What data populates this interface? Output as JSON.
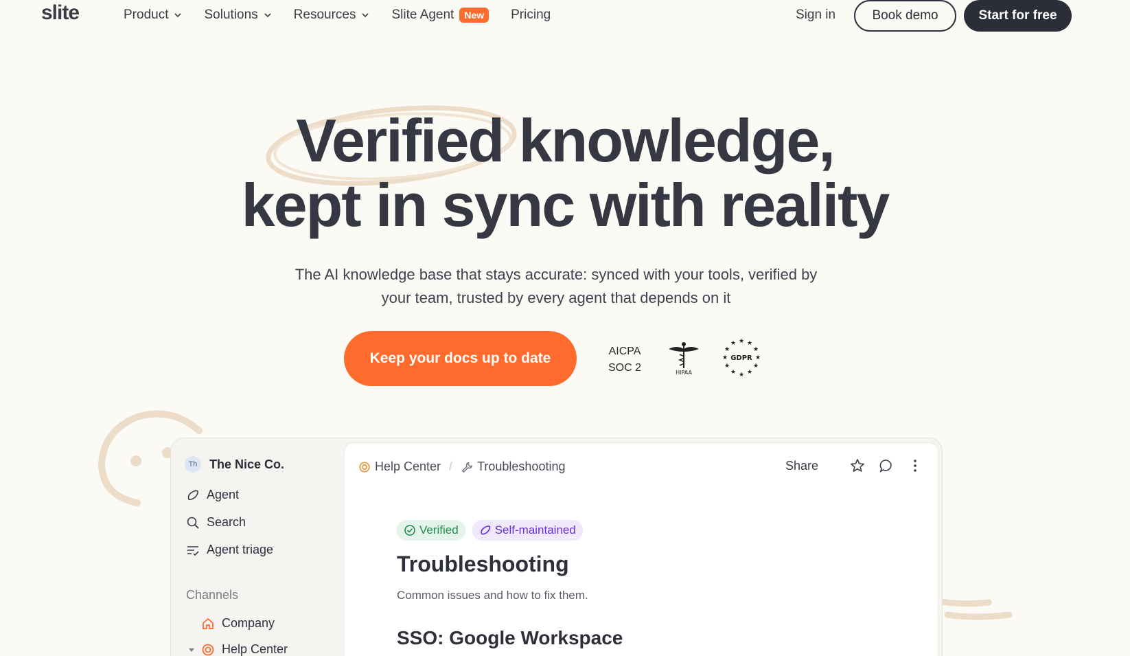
{
  "nav": {
    "logo": "slite",
    "links": [
      {
        "label": "Product",
        "dropdown": true
      },
      {
        "label": "Solutions",
        "dropdown": true
      },
      {
        "label": "Resources",
        "dropdown": true
      },
      {
        "label": "Slite Agent",
        "badge": "New"
      },
      {
        "label": "Pricing"
      }
    ],
    "sign_in": "Sign in",
    "book_demo": "Book demo",
    "start_free": "Start for free"
  },
  "hero": {
    "title_line1": "Verified knowledge,",
    "title_line2": "kept in sync with reality",
    "subtitle_line1": "The AI knowledge base that stays accurate: synced with your tools, verified by",
    "subtitle_line2": "your team, trusted by every agent that depends on it",
    "cta": "Keep your docs up to date"
  },
  "certs": {
    "aicpa_line1": "AICPA",
    "aicpa_line2": "SOC 2",
    "hipaa": "HIPAA COMPLIANT",
    "gdpr": "GDPR"
  },
  "app": {
    "workspace_initials": "Th",
    "workspace_name": "The Nice Co.",
    "sidebar_items": [
      "Agent",
      "Search",
      "Agent triage"
    ],
    "channels_heading": "Channels",
    "channels": [
      "Company",
      "Help Center"
    ],
    "breadcrumb": [
      "Help Center",
      "Troubleshooting"
    ],
    "share": "Share",
    "tags": [
      "Verified",
      "Self-maintained"
    ],
    "doc_title": "Troubleshooting",
    "doc_desc": "Common issues and how to fix them.",
    "doc_h2": "SSO: Google Workspace"
  },
  "colors": {
    "accent": "#ff6b2c",
    "dark": "#2b2d38",
    "background": "#fcfaf5",
    "verified": "#1f8a4c",
    "self_maintained": "#6a2fd0"
  }
}
